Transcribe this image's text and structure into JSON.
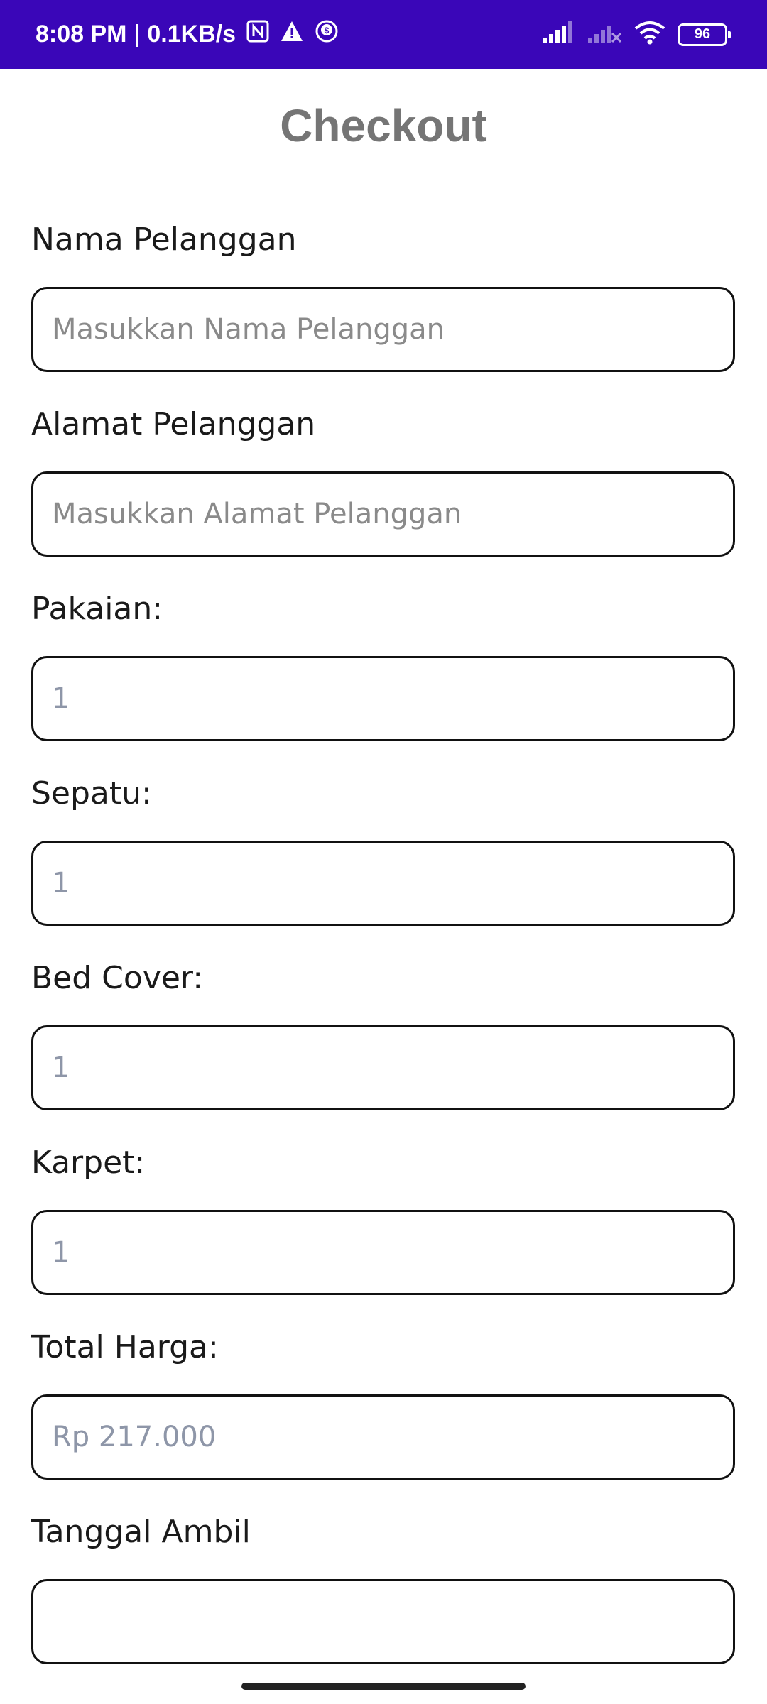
{
  "status_bar": {
    "time": "8:08 PM",
    "separator": "|",
    "network_speed": "0.1KB/s",
    "battery": "96",
    "icons": [
      "nfc-icon",
      "warning-icon",
      "s-app-icon",
      "signal-icon",
      "signal-off-icon",
      "wifi-icon",
      "battery-icon"
    ]
  },
  "page": {
    "title": "Checkout"
  },
  "form": {
    "nama_label": "Nama Pelanggan",
    "nama_placeholder": "Masukkan Nama Pelanggan",
    "alamat_label": "Alamat Pelanggan",
    "alamat_placeholder": "Masukkan Alamat Pelanggan",
    "pakaian_label": "Pakaian:",
    "pakaian_value": "1",
    "sepatu_label": "Sepatu:",
    "sepatu_value": "1",
    "bedcover_label": "Bed Cover:",
    "bedcover_value": "1",
    "karpet_label": "Karpet:",
    "karpet_value": "1",
    "total_label": "Total Harga:",
    "total_value": "Rp 217.000",
    "tanggal_label": "Tanggal Ambil",
    "tanggal_value": ""
  },
  "colors": {
    "status_bar": "#3a06b8",
    "title": "#757575",
    "field_border": "#111111",
    "value_text": "#8e96a8"
  }
}
